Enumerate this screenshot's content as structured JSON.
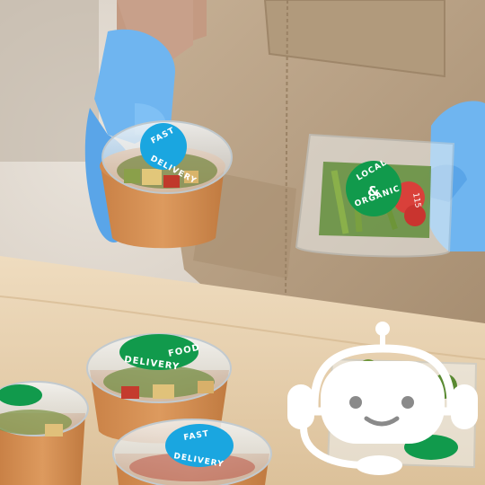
{
  "photo": {
    "stickers": {
      "fast_top": [
        "FAST",
        "DELIVERY"
      ],
      "local": [
        "LOCAL",
        "&",
        "ORGANIC"
      ],
      "food_delivery": [
        "FOOD",
        "DELIVERY"
      ],
      "fast_bottom": [
        "FAST",
        "DELIVERY"
      ],
      "lid_number": "115"
    }
  },
  "overlay": {
    "icon": "robot-headset-icon"
  },
  "colors": {
    "sticker_blue": "#1aa6e0",
    "sticker_green": "#119a4c",
    "glove_blue": "#6fb5f0",
    "bowl_orange": "#d08a4c",
    "apron": "#b9a184",
    "table": "#e6cfae"
  }
}
